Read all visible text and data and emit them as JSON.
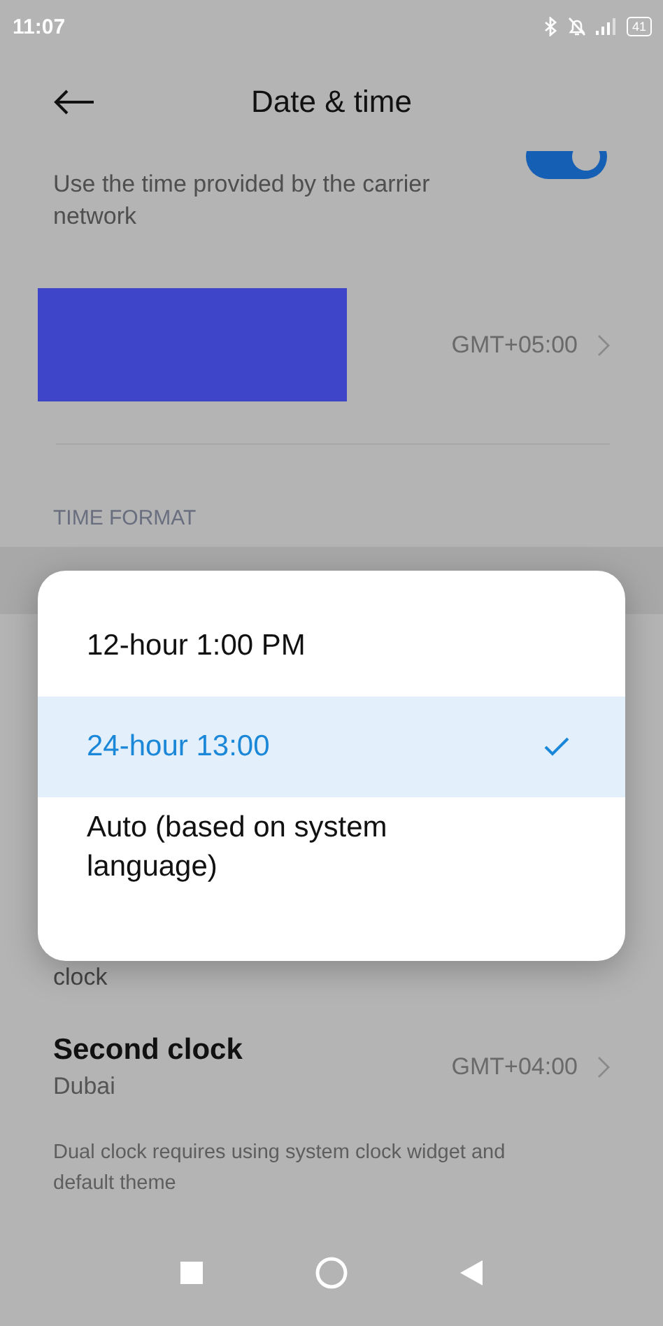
{
  "status_bar": {
    "time": "11:07",
    "battery": "41"
  },
  "header": {
    "title": "Date & time"
  },
  "auto_time": {
    "description": "Use the time provided by the carrier network",
    "on": true
  },
  "time_zone": {
    "value": "GMT+05:00"
  },
  "section_label": "TIME FORMAT",
  "partial_item": {
    "title": "clock"
  },
  "second_clock": {
    "title": "Second clock",
    "subtitle": "Dubai",
    "value": "GMT+04:00"
  },
  "note": "Dual clock requires using system clock widget and default theme",
  "dialog": {
    "options": [
      {
        "label": "12-hour 1:00 PM",
        "selected": false
      },
      {
        "label": "24-hour 13:00",
        "selected": true
      },
      {
        "label": "Auto (based on system language)",
        "selected": false
      }
    ]
  }
}
